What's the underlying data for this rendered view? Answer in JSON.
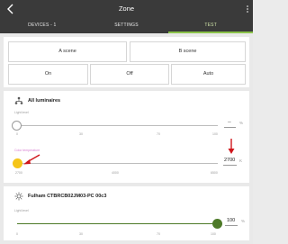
{
  "appbar": {
    "title": "Zone",
    "back_icon": "arrow-left-icon",
    "more_icon": "more-vertical-icon"
  },
  "tabs": [
    {
      "label": "DEVICES - 1",
      "active": false
    },
    {
      "label": "SETTINGS",
      "active": false
    },
    {
      "label": "TEST",
      "active": true
    }
  ],
  "scenes": {
    "scene_a": "A scene",
    "scene_b": "B scene",
    "on": "On",
    "off": "Off",
    "auto": "Auto"
  },
  "all_luminaires": {
    "title": "All luminaires",
    "icon": "group-icon",
    "light_level": {
      "label": "Light level",
      "ticks": [
        "0",
        "30",
        "70",
        "100"
      ],
      "value": "--",
      "unit": "%",
      "fraction": 0
    },
    "color_temperature": {
      "label": "Color temperature",
      "ticks": [
        "2700",
        "4000",
        "6500"
      ],
      "value": "2700",
      "unit": "K",
      "fraction": 0
    }
  },
  "device": {
    "title": "Fulham CTBRCB02JM03-PC 00c3",
    "icon": "bulb-icon",
    "light_level": {
      "label": "Light level",
      "ticks": [
        "0",
        "30",
        "70",
        "100"
      ],
      "value": "100",
      "unit": "%",
      "fraction": 1
    }
  },
  "colors": {
    "appbar": "#3a3a3a",
    "accent": "#8bc34a",
    "thumb_green": "#4d7a28",
    "thumb_yellow": "#f5c518",
    "annotation_red": "#d0151b",
    "color_temp_label": "#d77dd1"
  }
}
